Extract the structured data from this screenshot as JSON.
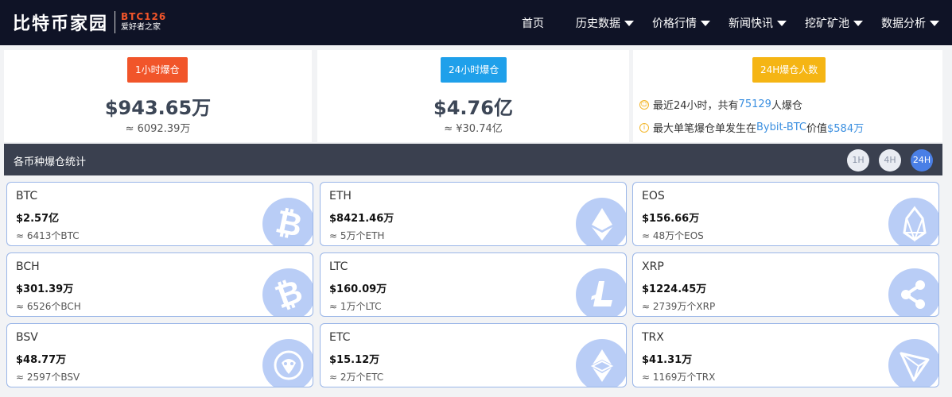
{
  "header": {
    "logo_text": "比特币家园",
    "logo_code": "BTC126",
    "logo_slogan": "爱好者之家",
    "nav": [
      {
        "label": "首页",
        "has_dropdown": false
      },
      {
        "label": "历史数据",
        "has_dropdown": true
      },
      {
        "label": "价格行情",
        "has_dropdown": true
      },
      {
        "label": "新闻快讯",
        "has_dropdown": true
      },
      {
        "label": "挖矿矿池",
        "has_dropdown": true
      },
      {
        "label": "数据分析",
        "has_dropdown": true
      }
    ]
  },
  "summary": {
    "hour1": {
      "tag": "1小时爆仓",
      "value": "$943.65万",
      "sub": "≈ 6092.39万",
      "tag_color": "#f1552a"
    },
    "hour24": {
      "tag": "24小时爆仓",
      "value": "$4.76亿",
      "sub": "≈ ¥30.74亿",
      "tag_color": "#1fa0ea"
    },
    "people": {
      "tag": "24H爆仓人数",
      "tag_color": "#f5b514",
      "line1_pre": "最近24小时，共有",
      "line1_num": "75129",
      "line1_post": "人爆仓",
      "line2_pre": "最大单笔爆仓单发生在",
      "line2_ex": "Bybit-BTC",
      "line2_mid": "价值",
      "line2_val": "$584万"
    }
  },
  "section": {
    "title": "各币种爆仓统计",
    "timeframes": [
      "1H",
      "4H",
      "24H"
    ],
    "active_timeframe": "24H"
  },
  "coins": [
    {
      "name": "BTC",
      "value": "$2.57亿",
      "sub": "≈ 6413个BTC",
      "icon": "bitcoin-icon"
    },
    {
      "name": "ETH",
      "value": "$8421.46万",
      "sub": "≈ 5万个ETH",
      "icon": "ethereum-icon"
    },
    {
      "name": "EOS",
      "value": "$156.66万",
      "sub": "≈ 48万个EOS",
      "icon": "eos-icon"
    },
    {
      "name": "BCH",
      "value": "$301.39万",
      "sub": "≈ 6526个BCH",
      "icon": "bitcoin-cash-icon"
    },
    {
      "name": "LTC",
      "value": "$160.09万",
      "sub": "≈ 1万个LTC",
      "icon": "litecoin-icon"
    },
    {
      "name": "XRP",
      "value": "$1224.45万",
      "sub": "≈ 2739万个XRP",
      "icon": "ripple-icon"
    },
    {
      "name": "BSV",
      "value": "$48.77万",
      "sub": "≈ 2597个BSV",
      "icon": "bsv-icon"
    },
    {
      "name": "ETC",
      "value": "$15.12万",
      "sub": "≈ 2万个ETC",
      "icon": "ethereum-classic-icon"
    },
    {
      "name": "TRX",
      "value": "$41.31万",
      "sub": "≈ 1169万个TRX",
      "icon": "tron-icon"
    }
  ]
}
